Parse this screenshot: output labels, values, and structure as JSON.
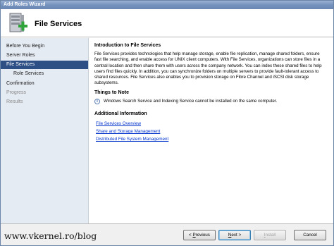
{
  "window": {
    "title": "Add Roles Wizard"
  },
  "header": {
    "title": "File Services",
    "icon": "server-add-icon"
  },
  "nav": {
    "items": [
      {
        "label": "Before You Begin",
        "state": "normal"
      },
      {
        "label": "Server Roles",
        "state": "normal"
      },
      {
        "label": "File Services",
        "state": "active"
      },
      {
        "label": "Role Services",
        "state": "normal"
      },
      {
        "label": "Confirmation",
        "state": "normal"
      },
      {
        "label": "Progress",
        "state": "disabled"
      },
      {
        "label": "Results",
        "state": "disabled"
      }
    ]
  },
  "content": {
    "intro_heading": "Introduction to File Services",
    "intro_text": "File Services provides technologies that help manage storage, enable file replication, manage shared folders, ensure fast file searching, and enable access for UNIX client computers. With File Services, organizations can store files in a central location and then share them with users across the company network. You can index these shared files to help users find files quickly. In addition, you can synchronize folders on multiple servers to provide fault-tolerant access to shared resources. File Services also enables you to provision storage on Fibre Channel and iSCSI disk storage subsystems.",
    "notes_heading": "Things to Note",
    "note_text": "Windows Search Service and Indexing Service cannot be installed on the same computer.",
    "info_heading": "Additional Information",
    "links": [
      "File Services Overview",
      "Share and Storage Management",
      "Distributed File System Management"
    ]
  },
  "footer": {
    "previous_prefix": "< ",
    "previous_accel": "P",
    "previous_rest": "revious",
    "next_accel": "N",
    "next_rest": "ext >",
    "install_accel": "I",
    "install_rest": "nstall",
    "cancel_label": "Cancel"
  },
  "watermark": "www.vkernel.ro/blog",
  "colors": {
    "active_nav": "#2e4f86",
    "nav_bg": "#e5ebf3",
    "link": "#0033cc"
  }
}
